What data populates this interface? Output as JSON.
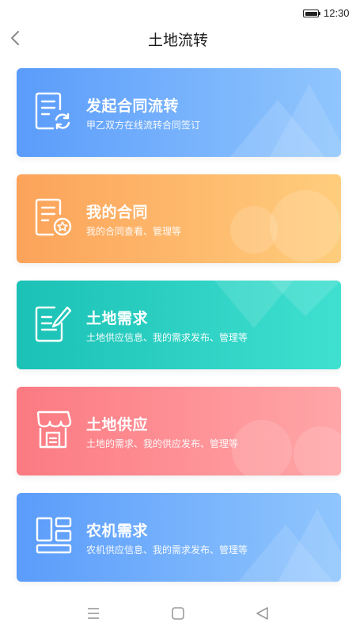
{
  "status_bar": {
    "time": "12:30"
  },
  "header": {
    "title": "土地流转",
    "back_icon": "chevron-left-icon"
  },
  "cards": [
    {
      "title": "发起合同流转",
      "desc": "甲乙双方在线流转合同签订",
      "icon": "document-sync-icon",
      "gradient_from": "#5b9cfb",
      "gradient_to": "#90c6fd"
    },
    {
      "title": "我的合同",
      "desc": "我的合同查看、管理等",
      "icon": "document-star-icon",
      "gradient_from": "#fca35a",
      "gradient_to": "#ffcd7d"
    },
    {
      "title": "土地需求",
      "desc": "土地供应信息、我的需求发布、管理等",
      "icon": "edit-note-icon",
      "gradient_from": "#1bc1b6",
      "gradient_to": "#3fe0d0"
    },
    {
      "title": "土地供应",
      "desc": "土地的需求、我的供应发布、管理等",
      "icon": "store-icon",
      "gradient_from": "#fc7a82",
      "gradient_to": "#ffa6a8"
    },
    {
      "title": "农机需求",
      "desc": "农机供应信息、我的需求发布、管理等",
      "icon": "grid-layout-icon",
      "gradient_from": "#5b9cfb",
      "gradient_to": "#90c6fd"
    }
  ],
  "system_nav": {
    "buttons": [
      "menu-icon",
      "home-square-icon",
      "back-triangle-icon"
    ]
  }
}
